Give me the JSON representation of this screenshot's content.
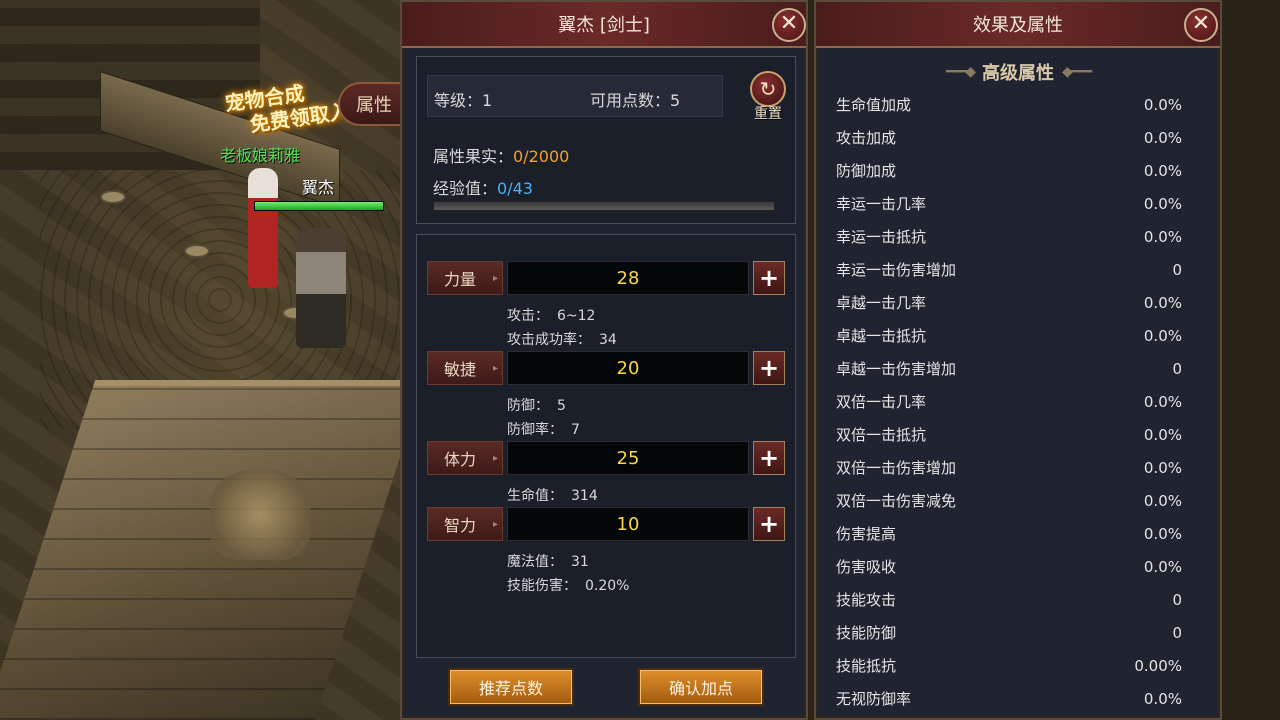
{
  "scene": {
    "promo_line1": "宠物合成",
    "promo_line2": "免费领取入口",
    "attr_tab": "属性",
    "npc_name": "老板娘莉雅",
    "player_name": "翼杰",
    "hp_fraction": 1.0
  },
  "character_panel": {
    "title": "翼杰 [剑士]",
    "close": "✕",
    "level_label": "等级：",
    "level_value": "1",
    "points_label": "可用点数：",
    "points_value": "5",
    "reset_label": "重置",
    "fruit_label": "属性果实：",
    "fruit_value": "0/2000",
    "exp_label": "经验值：",
    "exp_value": "0/43",
    "exp_fraction": 0,
    "stats": [
      {
        "label": "力量",
        "value": "28",
        "subs": [
          {
            "k": "攻击：",
            "v": "6~12"
          },
          {
            "k": "攻击成功率：",
            "v": "34"
          }
        ]
      },
      {
        "label": "敏捷",
        "value": "20",
        "subs": [
          {
            "k": "防御：",
            "v": "5"
          },
          {
            "k": "防御率：",
            "v": "7"
          }
        ]
      },
      {
        "label": "体力",
        "value": "25",
        "subs": [
          {
            "k": "生命值：",
            "v": "314"
          }
        ]
      },
      {
        "label": "智力",
        "value": "10",
        "subs": [
          {
            "k": "魔法值：",
            "v": "31"
          },
          {
            "k": "技能伤害：",
            "v": "0.20%"
          }
        ]
      }
    ],
    "plus": "+",
    "recommend_button": "推荐点数",
    "confirm_button": "确认加点"
  },
  "effects_panel": {
    "title": "效果及属性",
    "close": "✕",
    "section_title": "高级属性",
    "rows": [
      {
        "name": "生命值加成",
        "value": "0.0%"
      },
      {
        "name": "攻击加成",
        "value": "0.0%"
      },
      {
        "name": "防御加成",
        "value": "0.0%"
      },
      {
        "name": "幸运一击几率",
        "value": "0.0%"
      },
      {
        "name": "幸运一击抵抗",
        "value": "0.0%"
      },
      {
        "name": "幸运一击伤害增加",
        "value": "0"
      },
      {
        "name": "卓越一击几率",
        "value": "0.0%"
      },
      {
        "name": "卓越一击抵抗",
        "value": "0.0%"
      },
      {
        "name": "卓越一击伤害增加",
        "value": "0"
      },
      {
        "name": "双倍一击几率",
        "value": "0.0%"
      },
      {
        "name": "双倍一击抵抗",
        "value": "0.0%"
      },
      {
        "name": "双倍一击伤害增加",
        "value": "0.0%"
      },
      {
        "name": "双倍一击伤害减免",
        "value": "0.0%"
      },
      {
        "name": "伤害提高",
        "value": "0.0%"
      },
      {
        "name": "伤害吸收",
        "value": "0.0%"
      },
      {
        "name": "技能攻击",
        "value": "0"
      },
      {
        "name": "技能防御",
        "value": "0"
      },
      {
        "name": "技能抵抗",
        "value": "0.00%"
      },
      {
        "name": "无视防御率",
        "value": "0.0%"
      }
    ]
  }
}
